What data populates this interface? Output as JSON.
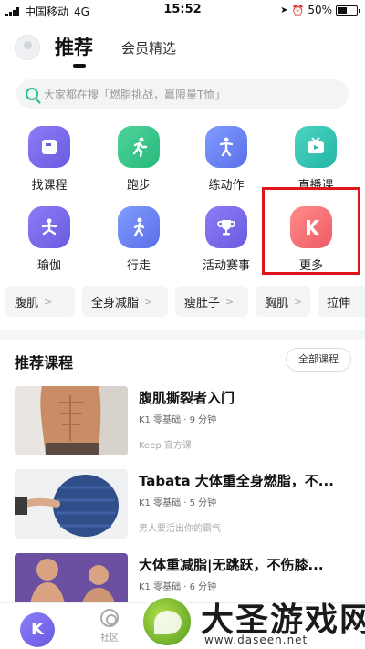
{
  "status_bar": {
    "carrier": "中国移动",
    "network": "4G",
    "time": "15:52",
    "battery": "50%",
    "battery_level": 0.5
  },
  "header": {
    "tab_active": "推荐",
    "tab_other": "会员精选"
  },
  "search": {
    "placeholder": "大家都在搜「燃脂挑战，赢限量T恤」"
  },
  "grid": {
    "items": [
      {
        "label": "找课程",
        "icon": "book-icon",
        "color": "#7b6cf0"
      },
      {
        "label": "跑步",
        "icon": "running-icon",
        "color": "#3cc98b"
      },
      {
        "label": "练动作",
        "icon": "workout-icon",
        "color": "#6a85f8"
      },
      {
        "label": "直播课",
        "icon": "tv-icon",
        "color": "#35c6b2"
      },
      {
        "label": "瑜伽",
        "icon": "yoga-icon",
        "color": "#7b6cf0"
      },
      {
        "label": "行走",
        "icon": "walking-icon",
        "color": "#6a85f8"
      },
      {
        "label": "活动赛事",
        "icon": "trophy-icon",
        "color": "#7b6cf0"
      },
      {
        "label": "更多",
        "icon": "keep-logo-icon",
        "color": "#f26b73"
      }
    ]
  },
  "chips": [
    "腹肌",
    "全身减脂",
    "瘦肚子",
    "胸肌",
    "拉伸"
  ],
  "section": {
    "title": "推荐课程",
    "all_button": "全部课程"
  },
  "courses": [
    {
      "title": "腹肌撕裂者入门",
      "meta": "K1 零基础 · 9 分钟",
      "source": "Keep 官方课"
    },
    {
      "title": "Tabata 大体重全身燃脂，不...",
      "meta": "K1 零基础 · 5 分钟",
      "source": "男人要活出你的霸气"
    },
    {
      "title": "大体重减脂|无跳跃，不伤膝...",
      "meta": "K1 零基础 · 6 分钟",
      "source": ""
    }
  ],
  "bottom_nav": {
    "home_glyph": "K",
    "community": "社区"
  },
  "watermark": {
    "name": "大圣游戏网",
    "url": "www.daseen.net"
  }
}
